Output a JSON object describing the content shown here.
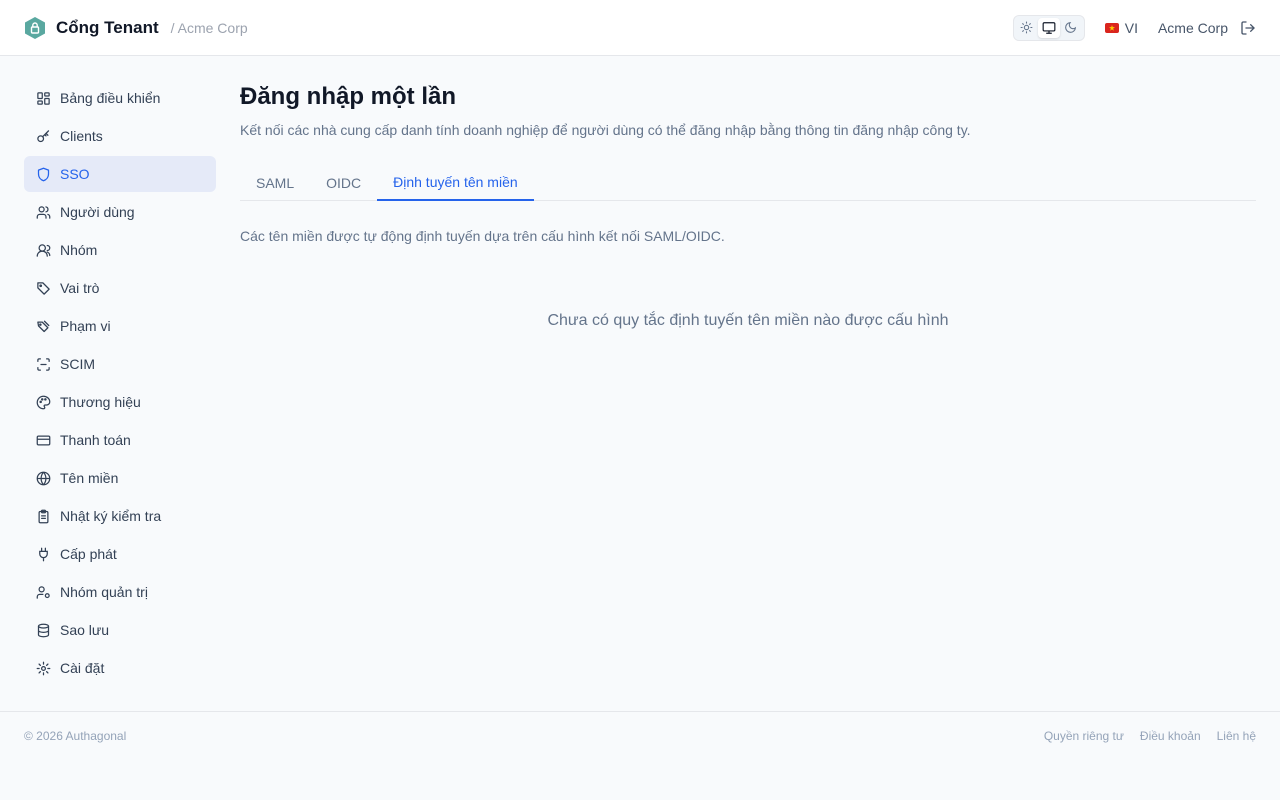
{
  "header": {
    "title": "Cổng Tenant",
    "tenant": "/ Acme Corp",
    "theme_options": [
      "sun-icon",
      "monitor-icon",
      "moon-icon"
    ],
    "theme_selected": "monitor-icon",
    "language": "VI",
    "organization": "Acme Corp",
    "brand_color": "#5aa8a0"
  },
  "sidebar": {
    "items": [
      {
        "label": "Bảng điều khiển",
        "icon": "dashboard-icon"
      },
      {
        "label": "Clients",
        "icon": "key-icon"
      },
      {
        "label": "SSO",
        "icon": "shield-icon",
        "active": true
      },
      {
        "label": "Người dùng",
        "icon": "users-icon"
      },
      {
        "label": "Nhóm",
        "icon": "group-icon"
      },
      {
        "label": "Vai trò",
        "icon": "tag-icon"
      },
      {
        "label": "Phạm vi",
        "icon": "tags-icon"
      },
      {
        "label": "SCIM",
        "icon": "scan-icon"
      },
      {
        "label": "Thương hiệu",
        "icon": "palette-icon"
      },
      {
        "label": "Thanh toán",
        "icon": "credit-card-icon"
      },
      {
        "label": "Tên miền",
        "icon": "globe-icon"
      },
      {
        "label": "Nhật ký kiểm tra",
        "icon": "clipboard-icon"
      },
      {
        "label": "Cấp phát",
        "icon": "plug-icon"
      },
      {
        "label": "Nhóm quản trị",
        "icon": "user-cog-icon"
      },
      {
        "label": "Sao lưu",
        "icon": "database-icon"
      },
      {
        "label": "Cài đặt",
        "icon": "gear-icon"
      }
    ],
    "active_color": "#2563eb"
  },
  "main": {
    "title": "Đăng nhập một lần",
    "description": "Kết nối các nhà cung cấp danh tính doanh nghiệp để người dùng có thể đăng nhập bằng thông tin đăng nhập công ty.",
    "tabs": [
      {
        "label": "SAML"
      },
      {
        "label": "OIDC"
      },
      {
        "label": "Định tuyến tên miền",
        "active": true
      }
    ],
    "tab_description": "Các tên miền được tự động định tuyến dựa trên cấu hình kết nối SAML/OIDC.",
    "empty_message": "Chưa có quy tắc định tuyến tên miền nào được cấu hình"
  },
  "footer": {
    "copyright": "© 2026 Authagonal",
    "links": [
      "Quyền riêng tư",
      "Điều khoản",
      "Liên hệ"
    ]
  }
}
